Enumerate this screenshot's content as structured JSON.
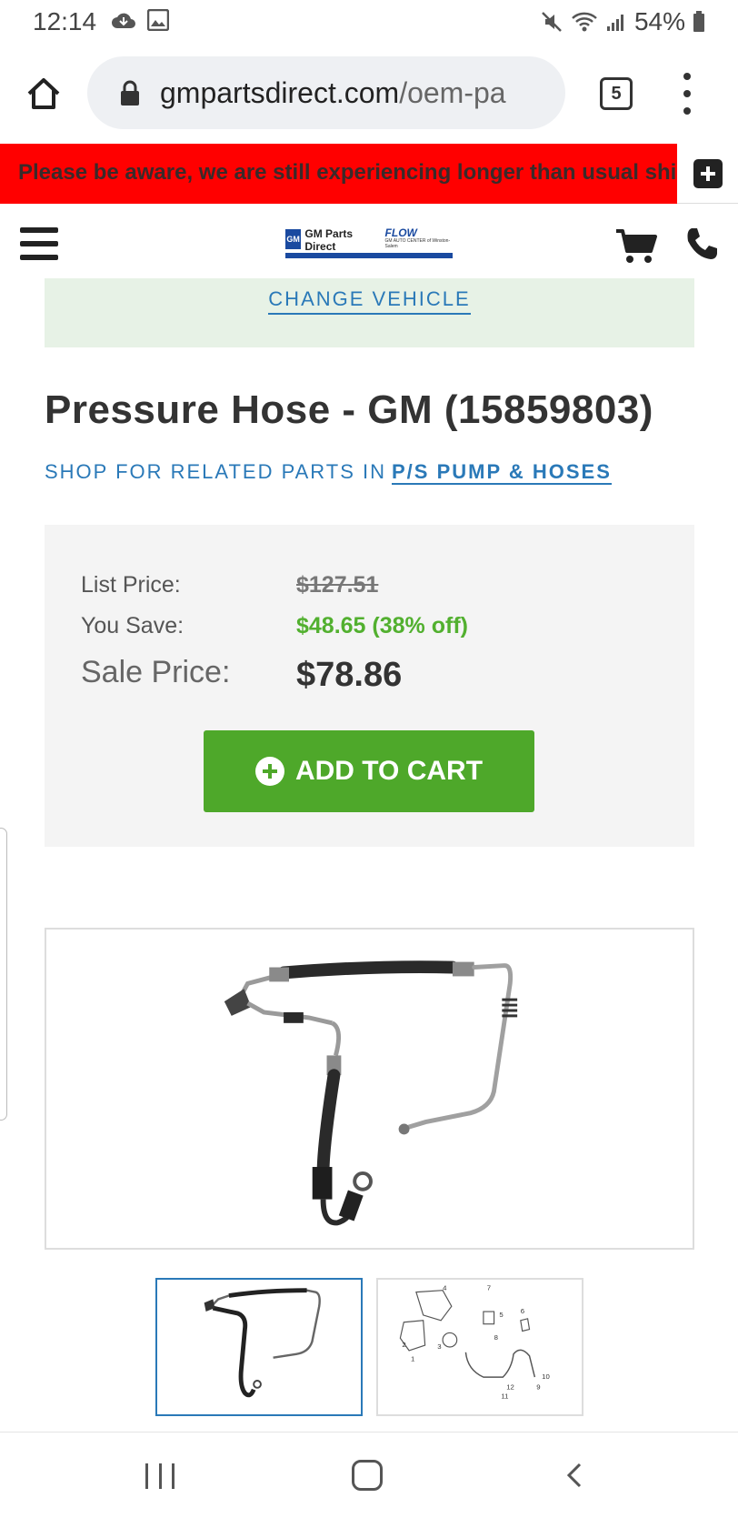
{
  "status_bar": {
    "time": "12:14",
    "battery": "54%"
  },
  "browser": {
    "url_domain": "gmpartsdirect.com",
    "url_path": "/oem-pa",
    "tab_count": "5"
  },
  "notice": {
    "text": "Please be aware, we are still experiencing longer than usual shipping"
  },
  "header": {
    "logo_title": "GM Parts Direct",
    "logo_partner": "FLOW",
    "logo_partner_sub": "GM AUTO CENTER of Winston-Salem"
  },
  "vehicle": {
    "change_label": "CHANGE VEHICLE"
  },
  "product": {
    "title": "Pressure Hose - GM (15859803)",
    "related_prefix": "SHOP FOR RELATED PARTS IN",
    "related_link": "P/S PUMP & HOSES"
  },
  "pricing": {
    "list_label": "List Price:",
    "list_value": "$127.51",
    "save_label": "You Save:",
    "save_value": "$48.65 (38% off)",
    "sale_label": "Sale Price:",
    "sale_value": "$78.86",
    "add_to_cart": "ADD TO CART"
  },
  "colors": {
    "notice_bg": "#ff0000",
    "link": "#2a79b8",
    "savings": "#52b02f",
    "cart_button": "#4ea82a",
    "vehicle_bg": "#e7f2e6"
  },
  "diagram_callouts": [
    "4",
    "7",
    "5",
    "6",
    "8",
    "2",
    "1",
    "3",
    "10",
    "9",
    "12",
    "11"
  ]
}
